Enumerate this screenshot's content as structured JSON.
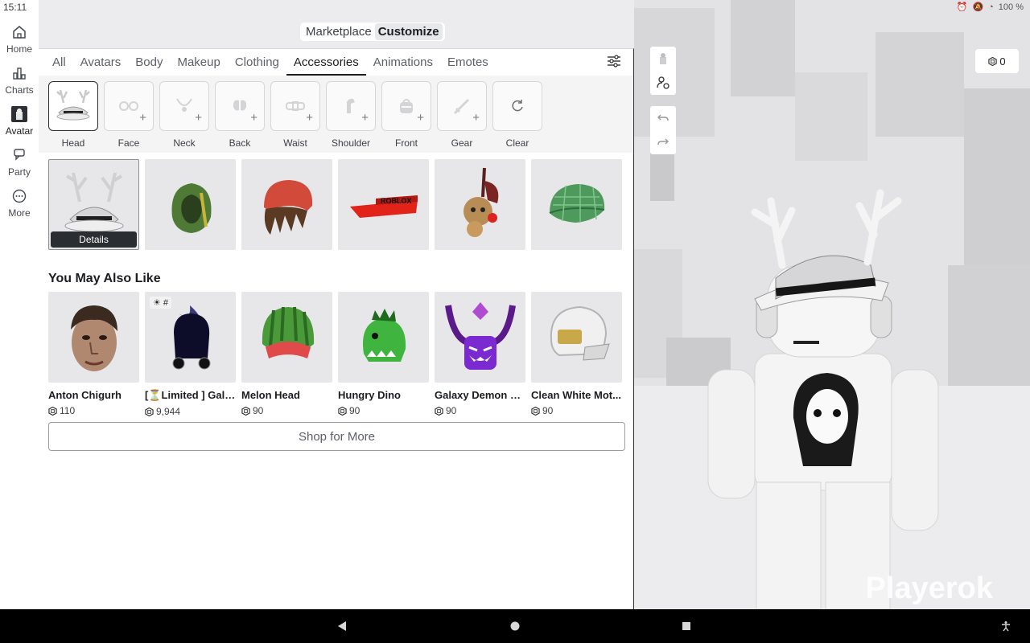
{
  "status": {
    "time": "15:11",
    "battery": "100 %"
  },
  "nav": {
    "items": [
      {
        "label": "Home",
        "icon": "home-icon"
      },
      {
        "label": "Charts",
        "icon": "charts-icon"
      },
      {
        "label": "Avatar",
        "icon": "avatar-icon"
      },
      {
        "label": "Party",
        "icon": "party-icon"
      },
      {
        "label": "More",
        "icon": "more-icon"
      }
    ],
    "active": "Avatar"
  },
  "segment": {
    "tabs": [
      "Marketplace",
      "Customize"
    ],
    "active": "Customize"
  },
  "categories": {
    "tabs": [
      "All",
      "Avatars",
      "Body",
      "Makeup",
      "Clothing",
      "Accessories",
      "Animations",
      "Emotes"
    ],
    "active": "Accessories"
  },
  "slots": [
    {
      "label": "Head",
      "icon": "antlers-hat-icon",
      "selected": true
    },
    {
      "label": "Face",
      "icon": "glasses-icon"
    },
    {
      "label": "Neck",
      "icon": "necklace-icon"
    },
    {
      "label": "Back",
      "icon": "wings-icon"
    },
    {
      "label": "Waist",
      "icon": "belt-icon"
    },
    {
      "label": "Shoulder",
      "icon": "parrot-icon"
    },
    {
      "label": "Front",
      "icon": "bag-icon"
    },
    {
      "label": "Gear",
      "icon": "sword-icon"
    },
    {
      "label": "Clear",
      "icon": "refresh-icon"
    }
  ],
  "owned_items": [
    {
      "name": "antlers-fedora",
      "details_label": "Details",
      "selected": true
    },
    {
      "name": "green-hood"
    },
    {
      "name": "red-beanie-hair"
    },
    {
      "name": "roblox-visor"
    },
    {
      "name": "monkey-shoulder-pal"
    },
    {
      "name": "green-plaid-cap"
    }
  ],
  "recommendations": {
    "title": "You May Also Like",
    "items": [
      {
        "name": "Anton Chigurh",
        "price": "110"
      },
      {
        "name": "[⏳Limited ] Gala...",
        "price": "9,944",
        "tag": "☀ #"
      },
      {
        "name": "Melon Head",
        "price": "90"
      },
      {
        "name": "Hungry Dino",
        "price": "90"
      },
      {
        "name": "Galaxy Demon H...",
        "price": "90"
      },
      {
        "name": "Clean White Mot...",
        "price": "90"
      }
    ]
  },
  "shop_button": "Shop for More",
  "preview": {
    "robux_balance": "0",
    "watermark": "Playerok"
  },
  "colors": {
    "accent": "#1b1d20",
    "tile_bg": "#e7e7ea",
    "preview_bg": "#e2e2e4"
  }
}
